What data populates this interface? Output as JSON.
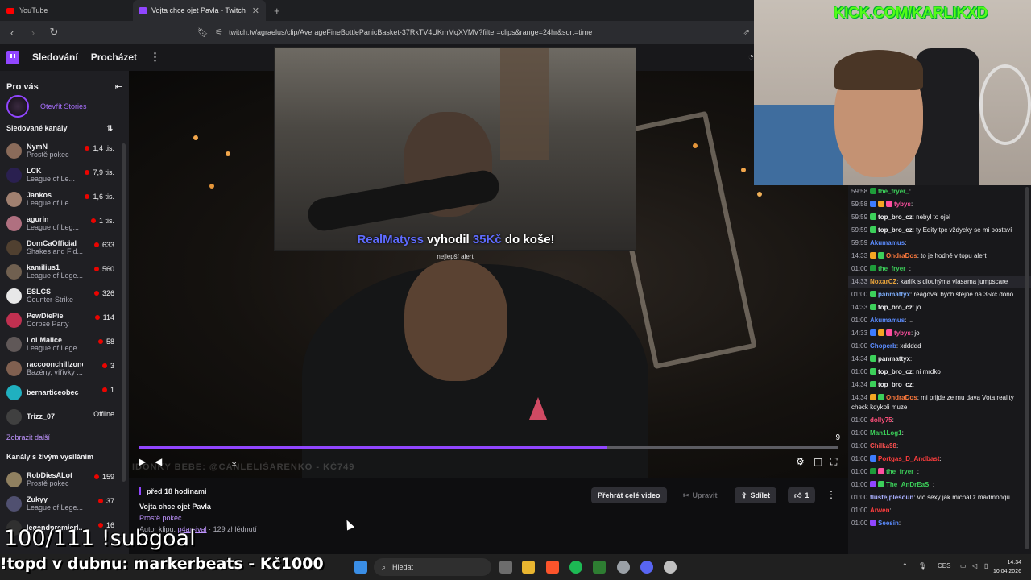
{
  "browser": {
    "tabs": [
      {
        "label": "YouTube",
        "active": false
      },
      {
        "label": "Vojta chce ojet Pavla - Twitch",
        "active": true
      }
    ],
    "new_tab": "+",
    "url": "twitch.tv/agraelus/clip/AverageFineBottlePanicBasket-37RkTV4UKmMqXVMV?filter=clips&range=24hr&sort=time"
  },
  "twitch_nav": {
    "following": "Sledování",
    "browse": "Procházet"
  },
  "sidebar": {
    "header": "Pro vás",
    "stories": "Otevřít Stories",
    "followed_title": "Sledované kanály",
    "channels": [
      {
        "name": "NymN",
        "game": "Prostě pokec",
        "viewers": "1,4 tis.",
        "color": "#8a6b5a"
      },
      {
        "name": "LCK",
        "game": "League of Le...",
        "viewers": "7,9 tis.",
        "color": "#2a2050"
      },
      {
        "name": "Jankos",
        "game": "League of Le...",
        "viewers": "1,6 tis.",
        "color": "#a08070"
      },
      {
        "name": "agurin",
        "game": "League of Leg...",
        "viewers": "1 tis.",
        "color": "#b07080"
      },
      {
        "name": "DomCaOfficial",
        "game": "Shakes and Fid...",
        "viewers": "633",
        "color": "#504030"
      },
      {
        "name": "kamilius1",
        "game": "League of Lege...",
        "viewers": "560",
        "color": "#706050"
      },
      {
        "name": "ESLCS",
        "game": "Counter-Strike",
        "viewers": "326",
        "color": "#e8e8e8"
      },
      {
        "name": "PewDiePie",
        "game": "Corpse Party",
        "viewers": "114",
        "color": "#c03050"
      },
      {
        "name": "LoLMalice",
        "game": "League of Lege...",
        "viewers": "58",
        "color": "#605858"
      },
      {
        "name": "raccoonchillzone",
        "game": "Bazény, vířivky ...",
        "viewers": "3",
        "color": "#806050"
      },
      {
        "name": "bernarticeobec",
        "game": "",
        "viewers": "1",
        "color": "#20b0c0"
      },
      {
        "name": "Trizz_07",
        "game": "",
        "viewers": "Offline",
        "color": "#404040"
      }
    ],
    "show_more": "Zobrazit další",
    "live_title": "Kanály s živým vysíláním",
    "live_channels": [
      {
        "name": "RobDiesALot",
        "game": "Prostě pokec",
        "viewers": "159",
        "color": "#908060"
      },
      {
        "name": "Zukyy",
        "game": "League of Lege...",
        "viewers": "37",
        "color": "#505070"
      },
      {
        "name": "legendpremierl...",
        "game": "",
        "viewers": "16",
        "color": "#303030"
      }
    ]
  },
  "player": {
    "watermark": "IDONKY BEBE: @CANLELIŠARENKO - KČ749",
    "progress": 0.67,
    "counter": "9",
    "alert_user": "RealMatyss",
    "alert_action": "vyhodil",
    "alert_amount": "35Kč",
    "alert_tail": "do koše!",
    "alert_sub": "nejlepší alert"
  },
  "clip_info": {
    "when": "před 18 hodinami",
    "title": "Vojta chce ojet Pavla",
    "category": "Prostě pokec",
    "author_prefix": "Autor klipu:",
    "author": "p4arsival",
    "views": "· 129 zhlédnutí",
    "watch_full": "Přehrát celé video",
    "edit": "Upravit",
    "share": "Sdílet",
    "likes": "1"
  },
  "webcam": {
    "kick": "KICK.COM/KARLIKXD"
  },
  "chat": [
    {
      "ts": "59:58",
      "user": "the_fryer_",
      "ucolor": "#3cd05a",
      "text": ":",
      "badges": [
        "#1e9c3a"
      ],
      "alt": false
    },
    {
      "ts": "59:58",
      "user": "tybys",
      "ucolor": "#ff4fa0",
      "text": ":",
      "badges": [
        "#3d7cff",
        "#f5a623",
        "#ff4fa0"
      ],
      "alt": false
    },
    {
      "ts": "59:59",
      "user": "top_bro_cz",
      "ucolor": "#efeff1",
      "text": ": nebyl to ojel",
      "badges": [
        "#3cd05a"
      ],
      "alt": false
    },
    {
      "ts": "59:59",
      "user": "top_bro_cz",
      "ucolor": "#efeff1",
      "text": ": ty Edity tpc vždycky se mi postaví",
      "badges": [
        "#3cd05a"
      ],
      "alt": false
    },
    {
      "ts": "59:59",
      "user": "Akumamus",
      "ucolor": "#5b8cff",
      "text": ":",
      "badges": [],
      "alt": false
    },
    {
      "ts": "14:33",
      "user": "OndraDos",
      "ucolor": "#ff7a3c",
      "text": ": to je hodně v topu alert",
      "badges": [
        "#f5a623",
        "#3cd05a"
      ],
      "alt": false
    },
    {
      "ts": "01:00",
      "user": "the_fryer_",
      "ucolor": "#3cd05a",
      "text": ":",
      "badges": [
        "#1e9c3a"
      ],
      "alt": false
    },
    {
      "ts": "14:33",
      "user": "NoxarCZ",
      "ucolor": "#e8a33a",
      "text": ": karlík s dlouhýma vlasama jumpscare",
      "badges": [],
      "alt": true
    },
    {
      "ts": "01:00",
      "user": "panmattyx",
      "ucolor": "#7fb0ff",
      "text": ": reagoval bych stejně na 35kč dono",
      "badges": [
        "#3cd05a"
      ],
      "alt": false
    },
    {
      "ts": "14:33",
      "user": "top_bro_cz",
      "ucolor": "#efeff1",
      "text": ": jo",
      "badges": [
        "#3cd05a"
      ],
      "alt": false
    },
    {
      "ts": "01:00",
      "user": "Akumamus",
      "ucolor": "#5b8cff",
      "text": ": ...",
      "badges": [],
      "alt": false
    },
    {
      "ts": "14:33",
      "user": "tybys",
      "ucolor": "#ff4fa0",
      "text": ": jo",
      "badges": [
        "#3d7cff",
        "#f5a623",
        "#ff4fa0"
      ],
      "alt": false
    },
    {
      "ts": "01:00",
      "user": "Chopcrb",
      "ucolor": "#5b8cff",
      "text": ": xddddd",
      "badges": [],
      "alt": false
    },
    {
      "ts": "14:34",
      "user": "panmattyx",
      "ucolor": "#efeff1",
      "text": ":",
      "badges": [
        "#3cd05a"
      ],
      "alt": false
    },
    {
      "ts": "01:00",
      "user": "top_bro_cz",
      "ucolor": "#efeff1",
      "text": ": ni mrdko",
      "badges": [
        "#3cd05a"
      ],
      "alt": false
    },
    {
      "ts": "14:34",
      "user": "top_bro_cz",
      "ucolor": "#efeff1",
      "text": ":",
      "badges": [
        "#3cd05a"
      ],
      "alt": false
    },
    {
      "ts": "14:34",
      "user": "OndraDos",
      "ucolor": "#ff7a3c",
      "text": ": mi prijde ze mu dava Vota reality check kdykoli muze",
      "badges": [
        "#f5a623",
        "#3cd05a"
      ],
      "alt": false
    },
    {
      "ts": "01:00",
      "user": "dolly75",
      "ucolor": "#ff4f7a",
      "text": ":",
      "badges": [],
      "alt": false
    },
    {
      "ts": "01:00",
      "user": "Man1Log1",
      "ucolor": "#3cd05a",
      "text": ":",
      "badges": [],
      "alt": false
    },
    {
      "ts": "01:00",
      "user": "Chilka98",
      "ucolor": "#ff5050",
      "text": ":",
      "badges": [],
      "alt": false
    },
    {
      "ts": "01:00",
      "user": "Portgas_D_Andbast",
      "ucolor": "#ff3d3d",
      "text": ":",
      "badges": [
        "#3d7cff"
      ],
      "alt": false
    },
    {
      "ts": "01:00",
      "user": "the_fryer_",
      "ucolor": "#3cd05a",
      "text": ":",
      "badges": [
        "#1e9c3a",
        "#ff4fa0"
      ],
      "alt": false
    },
    {
      "ts": "01:00",
      "user": "The_AnDrEaS_",
      "ucolor": "#3cd05a",
      "text": ":",
      "badges": [
        "#9146ff",
        "#3cd05a"
      ],
      "alt": false
    },
    {
      "ts": "01:00",
      "user": "tlustejplesoun",
      "ucolor": "#aab0ff",
      "text": ": víc sexy jak michal z madmonqu",
      "badges": [],
      "alt": false
    },
    {
      "ts": "01:00",
      "user": "Arwen",
      "ucolor": "#ff3d3d",
      "text": ":",
      "badges": [],
      "alt": false
    },
    {
      "ts": "01:00",
      "user": "Seesin",
      "ucolor": "#5b8cff",
      "text": ":",
      "badges": [
        "#9146ff"
      ],
      "alt": false
    }
  ],
  "taskbar": {
    "search": "Hledat",
    "lang": "CES",
    "time": "14:34",
    "date": "10.04.2026"
  },
  "overlays": {
    "subgoal": "100/111 !subgoal",
    "topd": "!topd v dubnu: markerbeats - Kč1000"
  }
}
